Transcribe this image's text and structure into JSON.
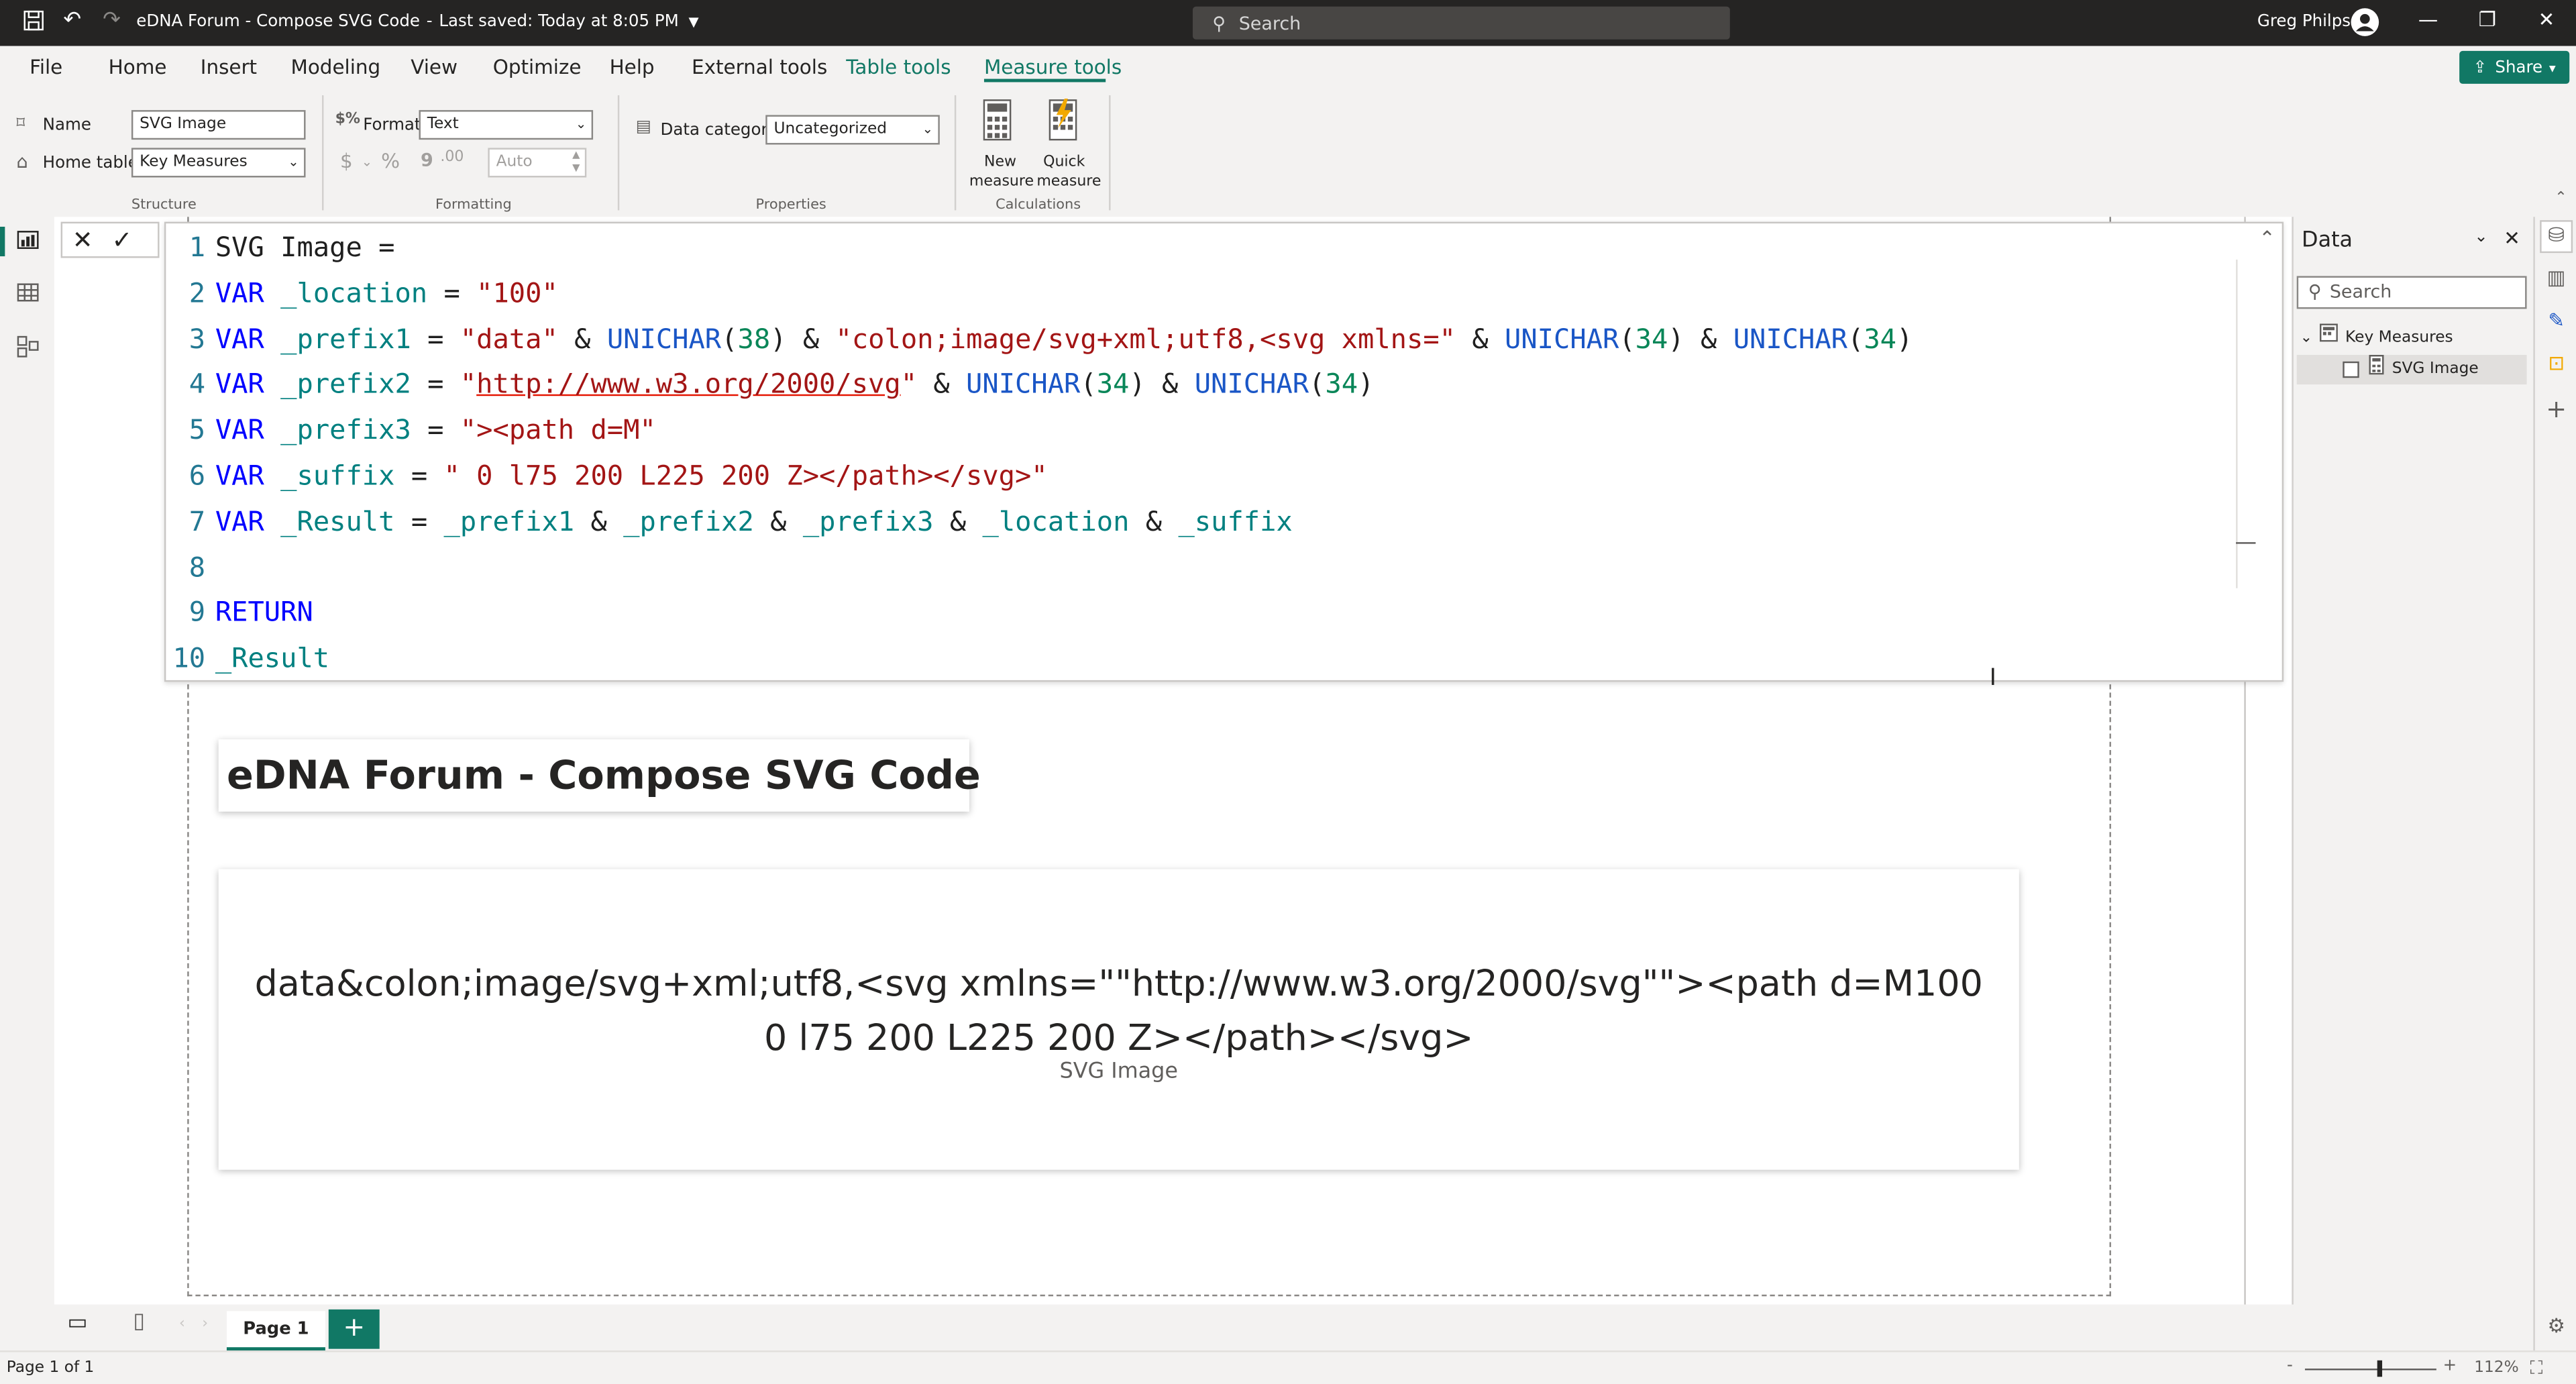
{
  "window": {
    "title": "eDNA Forum - Compose SVG Code",
    "last_saved": "Last saved: Today at 8:05 PM",
    "search_placeholder": "Search",
    "user": "Greg Philps"
  },
  "menu": {
    "items": [
      "File",
      "Home",
      "Insert",
      "Modeling",
      "View",
      "Optimize",
      "Help",
      "External tools",
      "Table tools",
      "Measure tools"
    ],
    "active": "Measure tools",
    "share": "Share"
  },
  "ribbon": {
    "name_label": "Name",
    "name_value": "SVG Image",
    "home_table_label": "Home table",
    "home_table_value": "Key Measures",
    "format_label": "Format",
    "format_value": "Text",
    "decimal_value": "Auto",
    "data_category_label": "Data category",
    "data_category_value": "Uncategorized",
    "new_measure": [
      "New",
      "measure"
    ],
    "quick_measure": [
      "Quick",
      "measure"
    ],
    "groups": {
      "structure": "Structure",
      "formatting": "Formatting",
      "properties": "Properties",
      "calculations": "Calculations"
    },
    "symbols": {
      "currency": "$",
      "percent": "%",
      "comma": "9",
      "decimals": ".00"
    }
  },
  "editor": {
    "line_numbers": [
      "1",
      "2",
      "3",
      "4",
      "5",
      "6",
      "7",
      "8",
      "9",
      "10"
    ],
    "lines": [
      [
        {
          "t": "SVG Image =",
          "c": "txt"
        }
      ],
      [
        {
          "t": "VAR ",
          "c": "kw"
        },
        {
          "t": "_location",
          "c": "var"
        },
        {
          "t": " = ",
          "c": "txt"
        },
        {
          "t": "\"100\"",
          "c": "str"
        }
      ],
      [
        {
          "t": "VAR ",
          "c": "kw"
        },
        {
          "t": "_prefix1",
          "c": "var"
        },
        {
          "t": " = ",
          "c": "txt"
        },
        {
          "t": "\"data\"",
          "c": "str"
        },
        {
          "t": " & ",
          "c": "txt"
        },
        {
          "t": "UNICHAR",
          "c": "fn"
        },
        {
          "t": "(",
          "c": "txt"
        },
        {
          "t": "38",
          "c": "num"
        },
        {
          "t": ") & ",
          "c": "txt"
        },
        {
          "t": "\"colon;image/svg+xml;utf8,<svg xmlns=\"",
          "c": "str"
        },
        {
          "t": " & ",
          "c": "txt"
        },
        {
          "t": "UNICHAR",
          "c": "fn"
        },
        {
          "t": "(",
          "c": "txt"
        },
        {
          "t": "34",
          "c": "num"
        },
        {
          "t": ") & ",
          "c": "txt"
        },
        {
          "t": "UNICHAR",
          "c": "fn"
        },
        {
          "t": "(",
          "c": "txt"
        },
        {
          "t": "34",
          "c": "num"
        },
        {
          "t": ")",
          "c": "txt"
        }
      ],
      [
        {
          "t": "VAR ",
          "c": "kw"
        },
        {
          "t": "_prefix2",
          "c": "var"
        },
        {
          "t": " = ",
          "c": "txt"
        },
        {
          "t": "\"",
          "c": "str"
        },
        {
          "t": "http://www.w3.org/2000/svg",
          "c": "url"
        },
        {
          "t": "\"",
          "c": "str"
        },
        {
          "t": " & ",
          "c": "txt"
        },
        {
          "t": "UNICHAR",
          "c": "fn"
        },
        {
          "t": "(",
          "c": "txt"
        },
        {
          "t": "34",
          "c": "num"
        },
        {
          "t": ") & ",
          "c": "txt"
        },
        {
          "t": "UNICHAR",
          "c": "fn"
        },
        {
          "t": "(",
          "c": "txt"
        },
        {
          "t": "34",
          "c": "num"
        },
        {
          "t": ")",
          "c": "txt"
        }
      ],
      [
        {
          "t": "VAR ",
          "c": "kw"
        },
        {
          "t": "_prefix3",
          "c": "var"
        },
        {
          "t": " = ",
          "c": "txt"
        },
        {
          "t": "\"><path d=M\"",
          "c": "str"
        }
      ],
      [
        {
          "t": "VAR ",
          "c": "kw"
        },
        {
          "t": "_suffix",
          "c": "var"
        },
        {
          "t": " = ",
          "c": "txt"
        },
        {
          "t": "\" 0 l75 200 L225 200 Z></path></svg>\"",
          "c": "str"
        }
      ],
      [
        {
          "t": "VAR ",
          "c": "kw"
        },
        {
          "t": "_Result",
          "c": "var"
        },
        {
          "t": " = ",
          "c": "txt"
        },
        {
          "t": "_prefix1",
          "c": "var"
        },
        {
          "t": " & ",
          "c": "txt"
        },
        {
          "t": "_prefix2",
          "c": "var"
        },
        {
          "t": " & ",
          "c": "txt"
        },
        {
          "t": "_prefix3",
          "c": "var"
        },
        {
          "t": " & ",
          "c": "txt"
        },
        {
          "t": "_location",
          "c": "var"
        },
        {
          "t": " & ",
          "c": "txt"
        },
        {
          "t": "_suffix",
          "c": "var"
        }
      ],
      [],
      [
        {
          "t": "RETURN",
          "c": "kw"
        }
      ],
      [
        {
          "t": "_Result",
          "c": "var"
        }
      ]
    ]
  },
  "report": {
    "title": "eDNA Forum - Compose SVG Code",
    "card_value_line1": "data&colon;image/svg+xml;utf8,<svg xmlns=\"\"http://www.w3.org/2000/svg\"\"><path d=M100",
    "card_value_line2": "0 l75 200 L225 200 Z></path></svg>",
    "card_label": "SVG Image"
  },
  "data_pane": {
    "title": "Data",
    "search_placeholder": "Search",
    "table": "Key Measures",
    "measure": "SVG Image"
  },
  "pages": {
    "tab": "Page 1",
    "add": "+"
  },
  "status": {
    "page_count": "Page 1 of 1",
    "zoom": "112%",
    "zoom_fraction": 0.56
  },
  "colors": {
    "accent": "#117865",
    "titlebar": "#252423"
  }
}
